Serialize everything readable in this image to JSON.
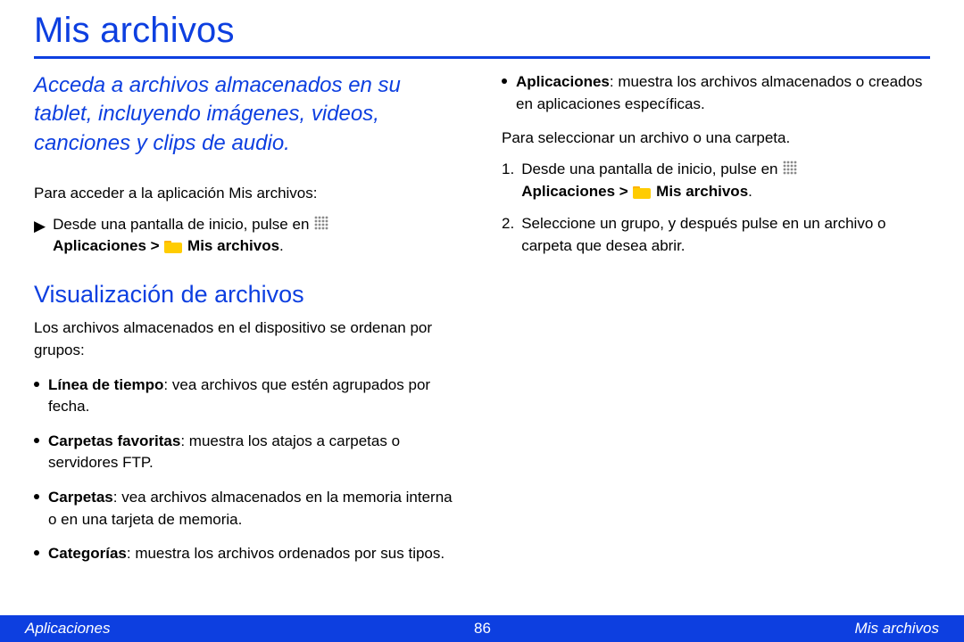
{
  "title": "Mis archivos",
  "intro": "Acceda a archivos almacenados en su tablet, incluyendo imágenes, videos, canciones y clips de audio.",
  "left": {
    "access_intro": "Para acceder a la aplicación Mis archivos:",
    "arrow_text": "Desde una pantalla de inicio, pulse en ",
    "apps_label": "Aplicaciones > ",
    "myfiles_label": " Mis archivos",
    "period": ".",
    "subhead": "Visualización de archivos",
    "after_sub": "Los archivos almacenados en el dispositivo se ordenan por grupos:",
    "bullets": [
      {
        "term": "Línea de tiempo",
        "desc": ": vea archivos que estén agrupados por fecha."
      },
      {
        "term": "Carpetas favoritas",
        "desc": ": muestra los atajos a carpetas o servidores FTP."
      },
      {
        "term": "Carpetas",
        "desc": ": vea archivos almacenados en la memoria interna o en una tarjeta de memoria."
      },
      {
        "term": "Categorías",
        "desc": ": muestra los archivos ordenados por sus tipos."
      }
    ]
  },
  "right": {
    "apps_bullet_term": "Aplicaciones",
    "apps_bullet_desc": ": muestra los archivos almacenados o creados en aplicaciones específicas.",
    "select_intro": "Para seleccionar un archivo o una carpeta.",
    "step1_pre": "Desde una pantalla de inicio, pulse en ",
    "step1_apps": "Aplicaciones > ",
    "step1_myfiles": " Mis archivos",
    "step1_period": ".",
    "step2": "Seleccione un grupo, y después pulse en un archivo o carpeta que desea abrir.",
    "n1": "1.",
    "n2": "2."
  },
  "footer": {
    "left": "Aplicaciones",
    "center": "86",
    "right": "Mis archivos"
  }
}
